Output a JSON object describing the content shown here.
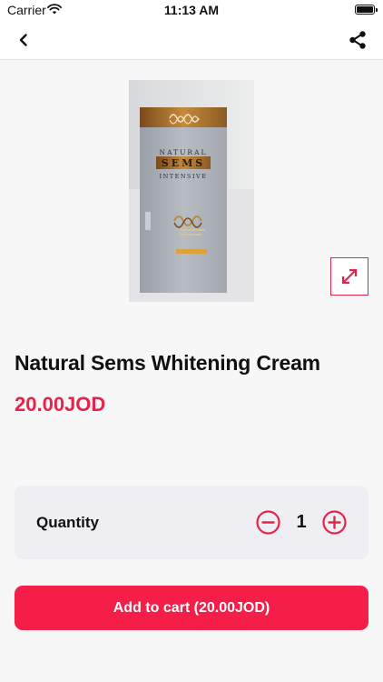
{
  "status_bar": {
    "carrier": "Carrier",
    "time": "11:13 AM",
    "icons": [
      "wifi-icon",
      "battery-icon"
    ]
  },
  "nav": {
    "back_icon": "chevron-left-icon",
    "share_icon": "share-icon"
  },
  "product": {
    "title": "Natural Sems Whitening Cream",
    "price": "20.00JOD",
    "image_text": {
      "line1": "NATURAL",
      "line2": "SEMS",
      "line3": "INTENSIVE"
    },
    "expand_icon": "expand-arrows-icon"
  },
  "quantity": {
    "label": "Quantity",
    "value": "1",
    "minus_icon": "minus-circle-icon",
    "plus_icon": "plus-circle-icon"
  },
  "cart": {
    "button_label": "Add to cart (20.00JOD)"
  },
  "colors": {
    "accent": "#f51e48",
    "price": "#e8234a",
    "background": "#f7f7f8",
    "card": "#efeff3"
  }
}
